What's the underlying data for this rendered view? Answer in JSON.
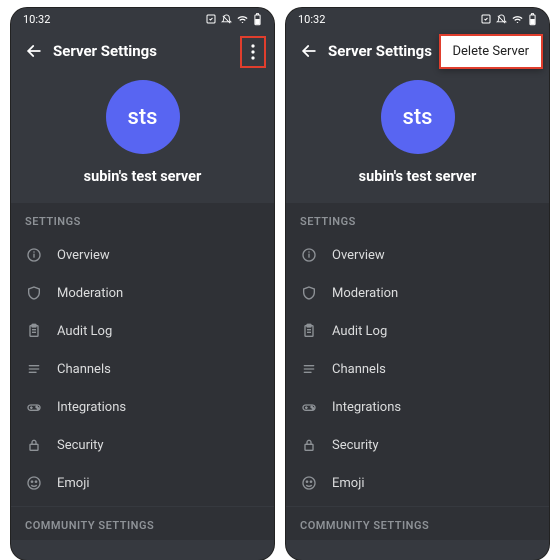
{
  "status": {
    "time": "10:32"
  },
  "header": {
    "title": "Server Settings"
  },
  "server": {
    "avatar_initials": "sts",
    "avatar_bg": "#5865F2",
    "name": "subin's test server"
  },
  "sections": {
    "settings_label": "SETTINGS",
    "community_label": "COMMUNITY SETTINGS"
  },
  "items": {
    "overview": "Overview",
    "moderation": "Moderation",
    "audit_log": "Audit Log",
    "channels": "Channels",
    "integrations": "Integrations",
    "security": "Security",
    "emoji": "Emoji"
  },
  "popup": {
    "delete_server": "Delete Server"
  }
}
